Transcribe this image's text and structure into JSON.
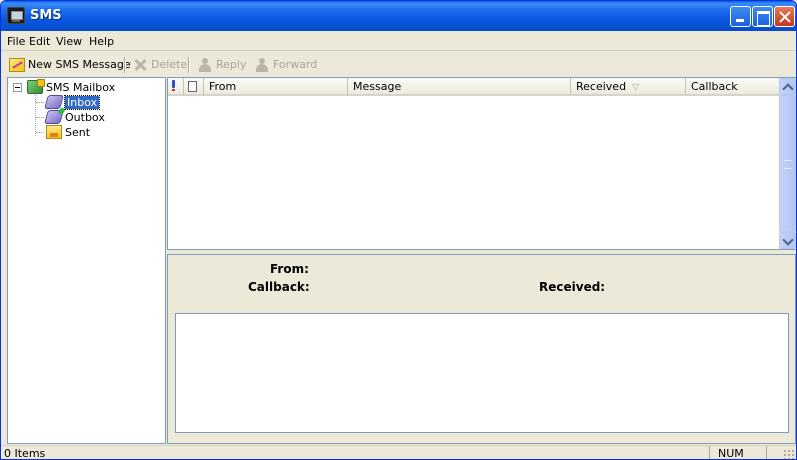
{
  "window": {
    "title": "SMS"
  },
  "menu": {
    "items": [
      "File",
      "Edit",
      "View",
      "Help"
    ]
  },
  "toolbar": {
    "new_message": "New SMS Message",
    "delete": "Delete",
    "reply": "Reply",
    "forward": "Forward"
  },
  "tree": {
    "root": "SMS Mailbox",
    "folders": [
      "Inbox",
      "Outbox",
      "Sent"
    ],
    "selected": "Inbox"
  },
  "list": {
    "columns": [
      "From",
      "Message",
      "Received",
      "Callback"
    ],
    "sorted_column": "Received",
    "rows": []
  },
  "preview": {
    "from_label": "From:",
    "callback_label": "Callback:",
    "received_label": "Received:"
  },
  "status": {
    "items": "0 Items",
    "num": "NUM"
  }
}
